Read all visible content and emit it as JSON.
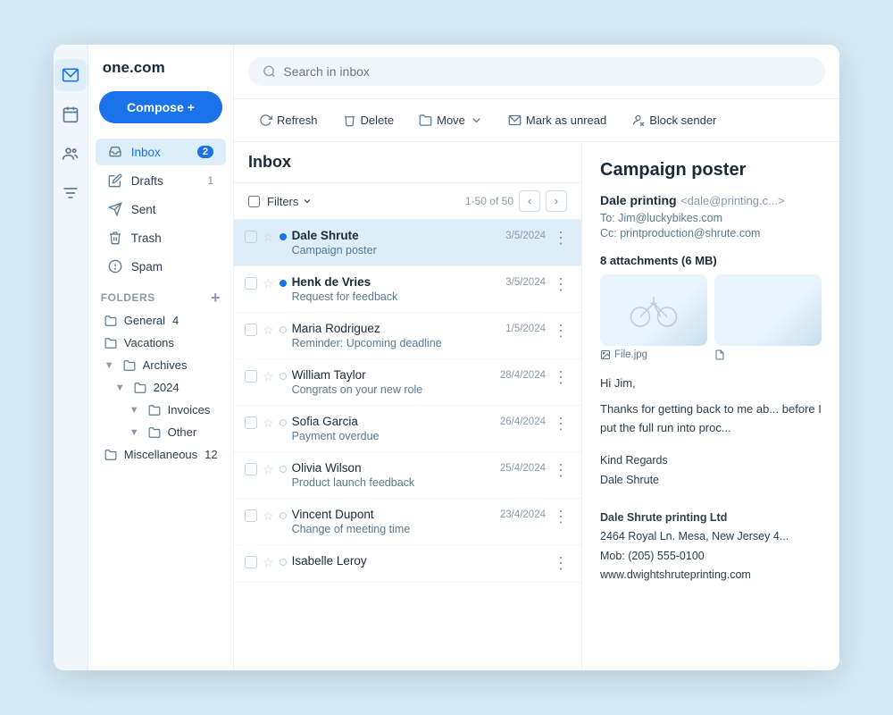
{
  "app": {
    "logo": "one.com",
    "compose_label": "Compose +",
    "search_placeholder": "Search in inbox"
  },
  "toolbar": {
    "refresh": "Refresh",
    "delete": "Delete",
    "move": "Move",
    "mark_unread": "Mark as unread",
    "block_sender": "Block sender"
  },
  "nav": {
    "inbox": "Inbox",
    "inbox_badge": "2",
    "drafts": "Drafts",
    "drafts_badge": "1",
    "sent": "Sent",
    "trash": "Trash",
    "spam": "Spam",
    "folders_header": "Folders",
    "folder_general": "General",
    "folder_general_badge": "4",
    "folder_vacations": "Vacations",
    "folder_archives": "Archives",
    "folder_2024": "2024",
    "folder_invoices": "Invoices",
    "folder_other": "Other",
    "folder_miscellaneous": "Miscellaneous",
    "folder_miscellaneous_badge": "12"
  },
  "email_list": {
    "title": "Inbox",
    "filters_label": "Filters",
    "pagination_text": "1-50 of 50",
    "emails": [
      {
        "from": "Dale Shrute",
        "subject": "Campaign poster",
        "date": "3/5/2024",
        "unread": true,
        "selected": true
      },
      {
        "from": "Henk de Vries",
        "subject": "Request for feedback",
        "date": "3/5/2024",
        "unread": true,
        "selected": false
      },
      {
        "from": "Maria Rodriguez",
        "subject": "Reminder: Upcoming deadline",
        "date": "1/5/2024",
        "unread": false,
        "selected": false
      },
      {
        "from": "William Taylor",
        "subject": "Congrats on your new role",
        "date": "28/4/2024",
        "unread": false,
        "selected": false
      },
      {
        "from": "Sofia Garcia",
        "subject": "Payment overdue",
        "date": "26/4/2024",
        "unread": false,
        "selected": false
      },
      {
        "from": "Olivia Wilson",
        "subject": "Product launch feedback",
        "date": "25/4/2024",
        "unread": false,
        "selected": false
      },
      {
        "from": "Vincent Dupont",
        "subject": "Change of meeting time",
        "date": "23/4/2024",
        "unread": false,
        "selected": false
      },
      {
        "from": "Isabelle Leroy",
        "subject": "",
        "date": "",
        "unread": false,
        "selected": false
      }
    ]
  },
  "detail": {
    "title": "Campaign poster",
    "from_name": "Dale printing",
    "from_email": "<dale@printing.c...>",
    "to": "To: Jim@luckybikes.com",
    "cc": "Cc: printproduction@shrute.com",
    "attachments_label": "8 attachments (6 MB)",
    "attachment_file": "File.jpg",
    "body_line1": "Hi Jim,",
    "body_line2": "Thanks for getting back to me ab... before I put the full run into proc...",
    "sign_regards": "Kind Regards",
    "sign_name": "Dale Shrute",
    "sig_company": "Dale Shrute printing Ltd",
    "sig_address": "2464 Royal Ln. Mesa, New Jersey 4...",
    "sig_mob": "Mob: (205) 555-0100",
    "sig_web": "www.dwightshruteprinting.com"
  }
}
